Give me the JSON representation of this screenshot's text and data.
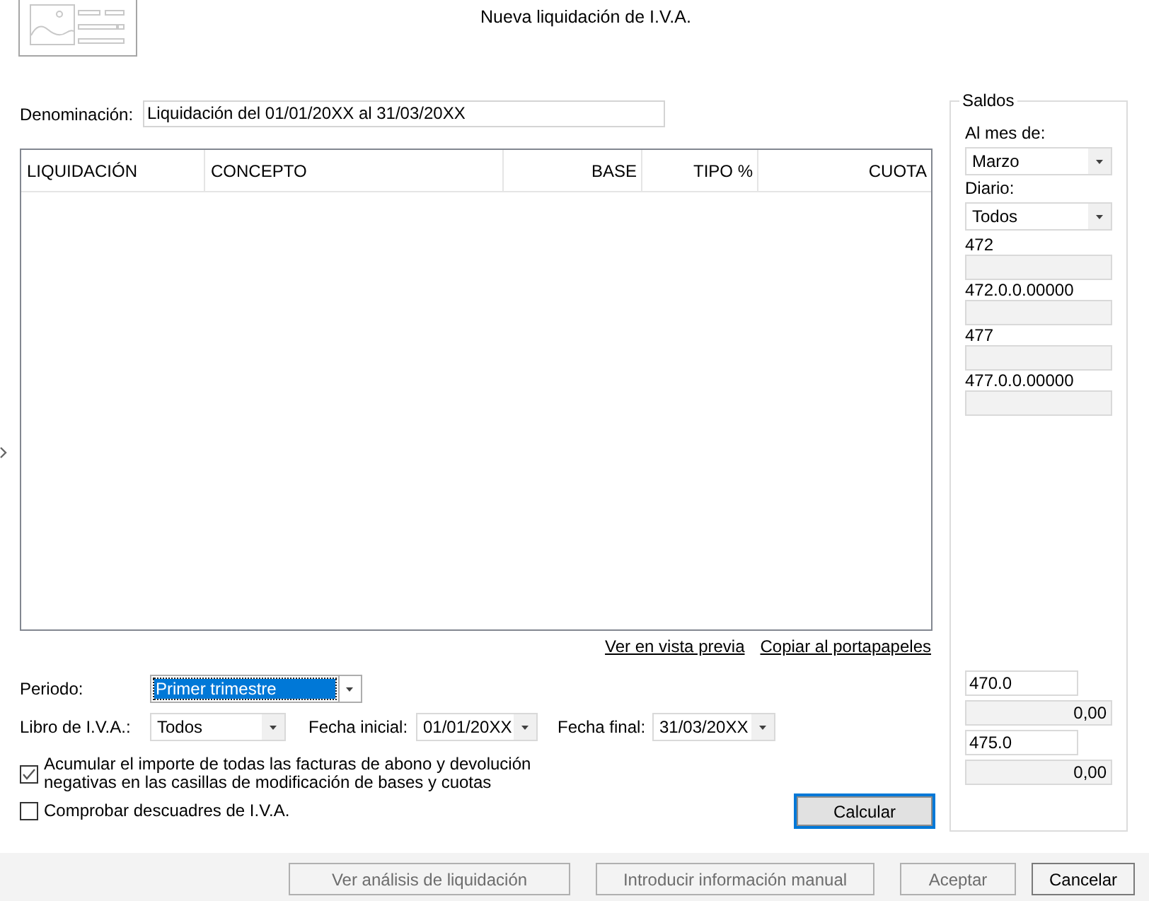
{
  "header": {
    "title": "Nueva liquidación de I.V.A."
  },
  "denominacion": {
    "label": "Denominación:",
    "value": "Liquidación del 01/01/20XX al 31/03/20XX"
  },
  "table": {
    "columns": [
      {
        "label": "LIQUIDACIÓN",
        "kind": "text"
      },
      {
        "label": "CONCEPTO",
        "kind": "text"
      },
      {
        "label": "BASE",
        "kind": "number"
      },
      {
        "label": "TIPO %",
        "kind": "number"
      },
      {
        "label": "CUOTA",
        "kind": "number"
      }
    ]
  },
  "links": [
    {
      "label": "Ver en vista previa"
    },
    {
      "label": "Copiar al portapapeles"
    }
  ],
  "periodo": {
    "label": "Periodo:",
    "value": "Primer trimestre",
    "highlighted": true
  },
  "filters": [
    {
      "label": "Libro de I.V.A.:",
      "value": "Todos"
    },
    {
      "label": "Fecha inicial:",
      "value": "01/01/20XX"
    },
    {
      "label": "Fecha final:",
      "value": "31/03/20XX"
    }
  ],
  "options": [
    {
      "label": "Acumular el importe de todas las facturas de abono y devolución negativas en las casillas de modificación de bases y cuotas",
      "checked": true
    },
    {
      "label": "Comprobar descuadres de I.V.A.",
      "checked": false
    }
  ],
  "calculate_button": {
    "label": "Calcular",
    "default": true
  },
  "saldos": {
    "title": "Saldos",
    "selects": [
      {
        "label": "Al mes de:",
        "value": "Marzo"
      },
      {
        "label": "Diario:",
        "value": "Todos"
      }
    ],
    "accounts": [
      {
        "label": "472"
      },
      {
        "label": "472.0.0.00000"
      },
      {
        "label": "477"
      },
      {
        "label": "477.0.0.00000"
      }
    ],
    "totals": [
      {
        "account": "470.0",
        "amount": "0,00"
      },
      {
        "account": "475.0",
        "amount": "0,00"
      }
    ]
  },
  "buttons": [
    {
      "label": "Ver análisis de liquidación",
      "disabled": true
    },
    {
      "label": "Introducir información manual",
      "disabled": true
    },
    {
      "label": "Aceptar",
      "disabled": true
    },
    {
      "label": "Cancelar",
      "disabled": false
    }
  ]
}
